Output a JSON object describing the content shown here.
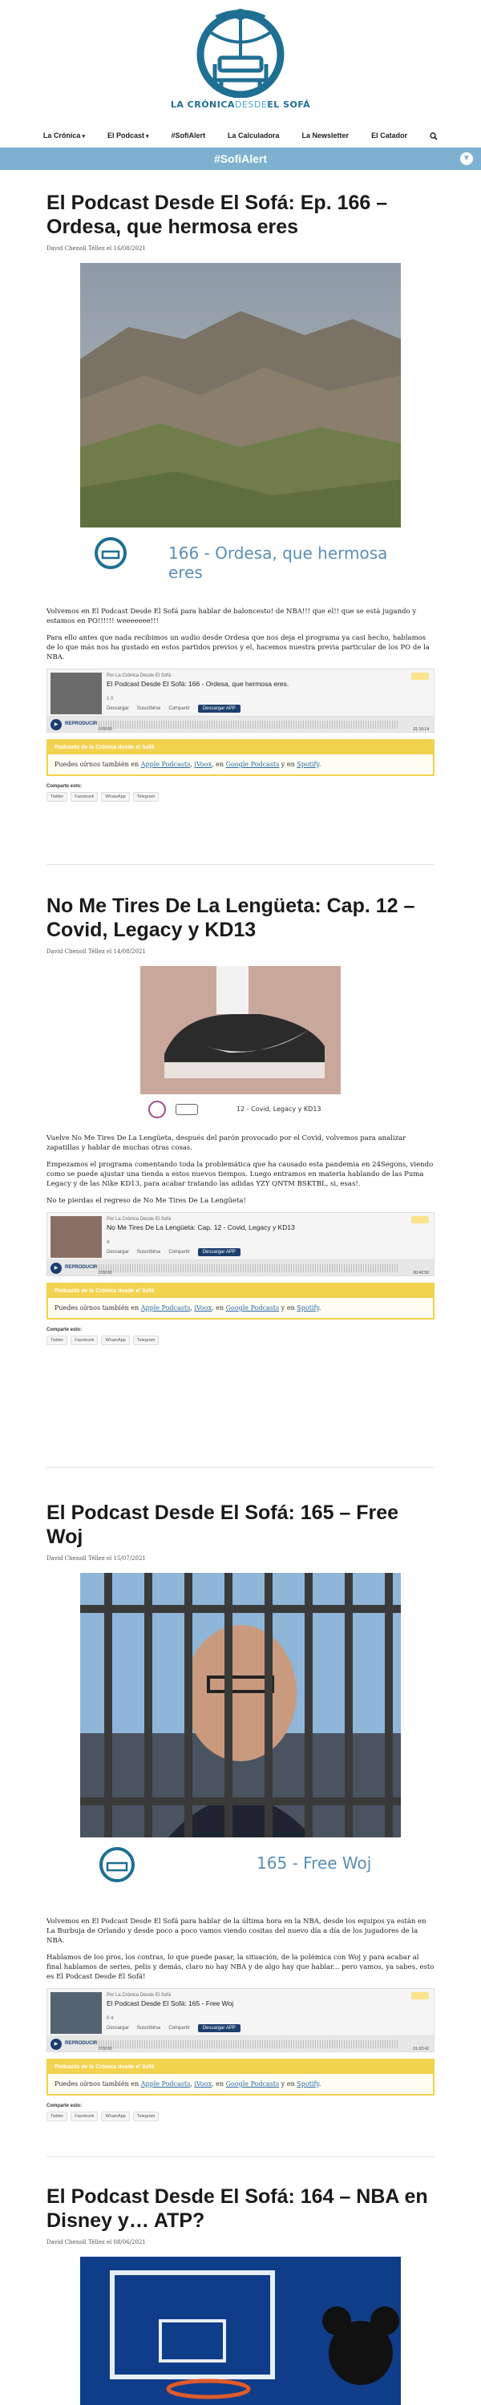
{
  "header": {
    "logo": {
      "word1": "LA CRÓNICA",
      "word2": "DESDE",
      "word3": "EL SOFÁ"
    },
    "nav": [
      {
        "label": "La Crónica",
        "dropdown": true
      },
      {
        "label": "El Podcast",
        "dropdown": true
      },
      {
        "label": "#SofiAlert",
        "dropdown": false
      },
      {
        "label": "La Calculadora",
        "dropdown": false
      },
      {
        "label": "La Newsletter",
        "dropdown": false
      },
      {
        "label": "El Catador",
        "dropdown": false
      }
    ],
    "search_icon": "search-icon",
    "alert_bar": {
      "label": "#SofiAlert",
      "toggle_icon": "chevron-down-icon"
    }
  },
  "colors": {
    "brand": "#1f6f93",
    "brand_light": "#48a7c8",
    "alert_bar": "#7db1cf",
    "promo": "#f2d24f",
    "player_btn": "#1d3e6e"
  },
  "common": {
    "promo_head": "Podcasts de la Crónica desde el Sofá",
    "promo_body_prefix": "Puedes oírnos también en",
    "promo_links": [
      "Apple Podcasts",
      "iVoox",
      "Google Podcasts",
      "Spotify"
    ],
    "share_label": "Comparte esto:",
    "share_buttons": [
      "Twitter",
      "Facebook",
      "WhatsApp",
      "Telegram"
    ],
    "player_by": "Por La Crónica Desde El Sofá",
    "player_download": "Descargar",
    "player_subscribe": "Suscribirse",
    "player_share": "Compartir",
    "player_app": "Descargar APP",
    "player_play": "REPRODUCIR",
    "player_start": "0:00:00"
  },
  "posts": [
    {
      "title": "El Podcast Desde El Sofá: Ep. 166 – Ordesa, que hermosa eres",
      "meta": "David Chenoll Téllez el 16/08/2021",
      "image_caption": "166 - Ordesa, que hermosa eres",
      "paragraphs": [
        "Volvemos en El Podcast Desde El Sofá para hablar de baloncesto! de NBA!!! que el!! que se está jugando y estamos en PO!!!!!! weeeeeee!!!",
        "Para ello antes que nada recibimos un audio desde Ordesa que nos deja el programa ya casi hecho, hablamos de lo que más nos ha gustado en estos partidos previos y el, hacemos nuestra previa particular de los PO de la NBA."
      ],
      "player": {
        "title": "El Podcast Desde El Sofá: 166 - Ordesa, que hermosa eres.",
        "duration": "01:10:14",
        "stats": "1   0"
      }
    },
    {
      "title": "No Me Tires De La Lengüeta: Cap. 12 – Covid, Legacy y KD13",
      "meta": "David Chenoll Téllez el 14/08/2021",
      "image_caption": "12 - Covid, Legacy y KD13",
      "paragraphs": [
        "Vuelve No Me Tires De La Lengüeta, después del parón provocado por el Covid, volvemos para analizar zapatillas y hablar de muchas otras cosas.",
        "Empezamos el programa comentando toda la problemática que ha causado esta pandemia en 24Segons, viendo como se puede ajustar una tienda a estos nuevos tiempos. Luego entramos en materia hablando de las Puma Legacy y de las Nike KD13, para acabar tratando las adidas YZY QNTM BSKTBL, si, esas!.",
        "No te pierdas el regreso de No Me Tires De La Lengüeta!"
      ],
      "player": {
        "title": "No Me Tires De La Lengüeta: Cap. 12 - Covid, Legacy y KD13",
        "duration": "00:42:50",
        "stats": "4"
      }
    },
    {
      "title": "El Podcast Desde El Sofá: 165 – Free Woj",
      "meta": "David Chenoll Téllez el 15/07/2021",
      "image_caption": "165 - Free Woj",
      "paragraphs": [
        "Volvemos en El Podcast Desde El Sofá para hablar de la última hora en la NBA, desde los equipos ya están en La Burbuja de Orlando y desde poco a poco vamos viendo cositas del nuevo día a día de los jugadores de la NBA.",
        "Hablamos de los pros, los contras, lo que puede pasar, la situación, de la polémica con Woj y para acabar al final hablamos de series, pelis y demás, claro no hay NBA y de algo hay que hablar... pero vamos, ya sabes, esto es El Podcast Desde El Sofá!"
      ],
      "player": {
        "title": "El Podcast Desde El Sofá: 165 - Free Woj",
        "duration": "01:03:42",
        "stats": "0   4"
      }
    },
    {
      "title": "El Podcast Desde El Sofá: 164 – NBA en Disney y… ATP?",
      "meta": "David Chenoll Téllez el 08/06/2021"
    }
  ]
}
